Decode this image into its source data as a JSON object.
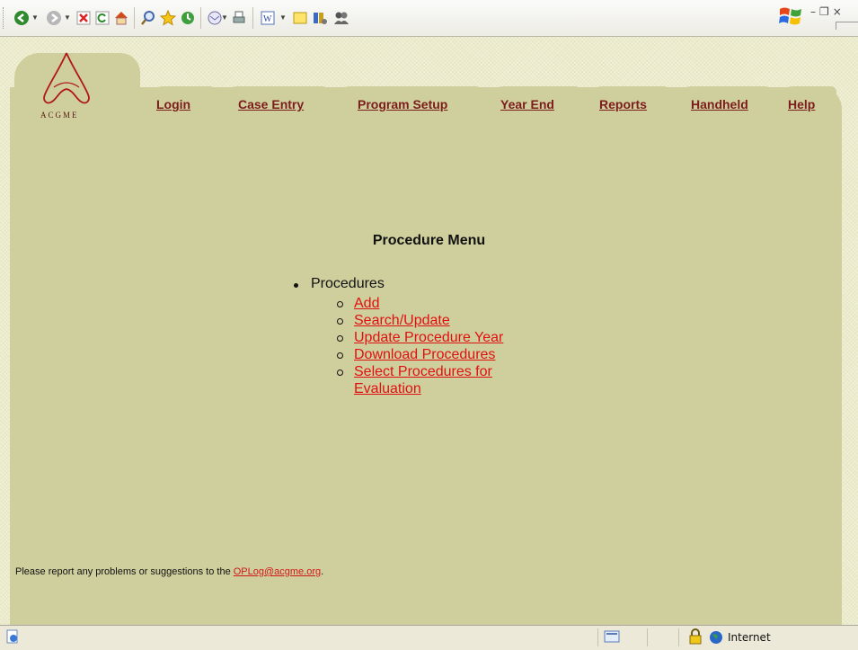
{
  "toolbar": {
    "icons": [
      "back-icon",
      "forward-icon",
      "stop-icon",
      "refresh-icon",
      "home-icon",
      "search-icon",
      "favorites-icon",
      "history-icon",
      "mail-icon",
      "print-icon",
      "edit-icon",
      "discuss-icon",
      "messenger-icon",
      "research-icon"
    ]
  },
  "logo": {
    "text": "ACGME"
  },
  "nav": {
    "items": [
      {
        "label": "Login"
      },
      {
        "label": "Case Entry"
      },
      {
        "label": "Program Setup"
      },
      {
        "label": "Year End"
      },
      {
        "label": "Reports"
      },
      {
        "label": "Handheld"
      },
      {
        "label": "Help"
      }
    ]
  },
  "main": {
    "title": "Procedure Menu",
    "root_item": "Procedures",
    "links": [
      {
        "label": "Add"
      },
      {
        "label": "Search/Update"
      },
      {
        "label": "Update Procedure Year"
      },
      {
        "label": "Download Procedures"
      },
      {
        "label": "Select Procedures for"
      },
      {
        "label": "Evaluation"
      }
    ]
  },
  "footer": {
    "text": "Please report any problems or suggestions to the ",
    "email": "OPLog@acgme.org",
    "end": "."
  },
  "status": {
    "zone": "Internet"
  },
  "colors": {
    "panel": "#cfcf9e",
    "nav_link": "#7c1c1c",
    "menu_link": "#e01010"
  }
}
